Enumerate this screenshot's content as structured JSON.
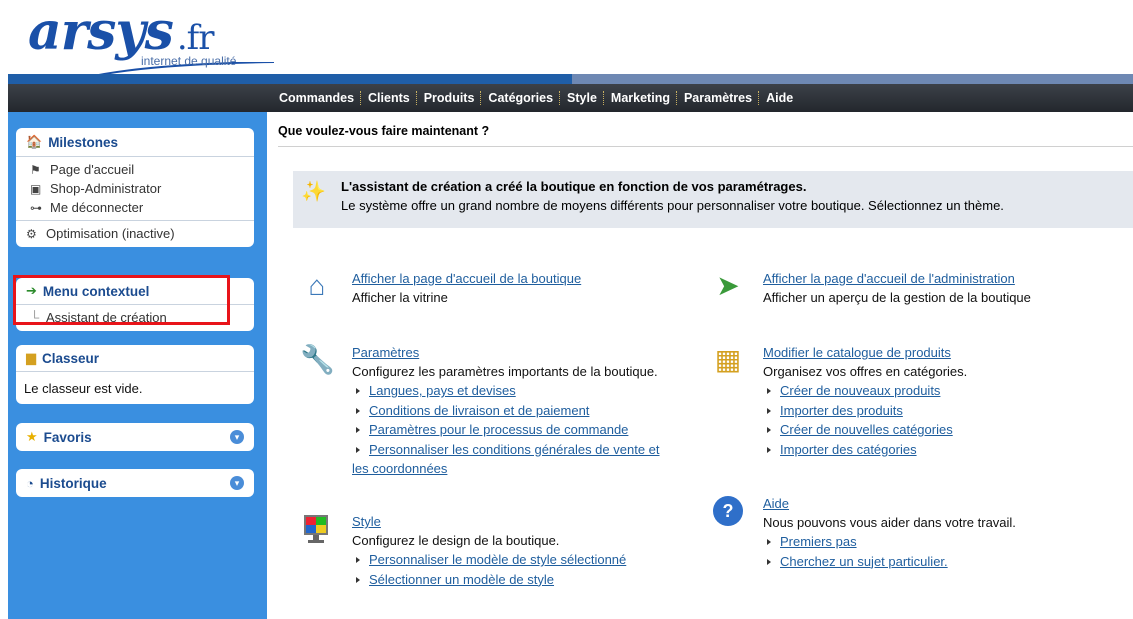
{
  "logo": {
    "name": "arsys",
    "tld": ".fr",
    "tagline": "internet de qualité"
  },
  "nav": [
    "Commandes",
    "Clients",
    "Produits",
    "Catégories",
    "Style",
    "Marketing",
    "Paramètres",
    "Aide"
  ],
  "sidebar": {
    "milestones": {
      "title": "Milestones",
      "items": [
        {
          "label": "Page d'accueil",
          "icon": "flag-icon"
        },
        {
          "label": "Shop-Administrator",
          "icon": "user-icon"
        },
        {
          "label": "Me déconnecter",
          "icon": "key-icon"
        }
      ],
      "optimisation": "Optimisation (inactive)"
    },
    "menu": {
      "title": "Menu contextuel",
      "item": "Assistant de création"
    },
    "classeur": {
      "title": "Classeur",
      "text": "Le classeur est vide."
    },
    "favoris": {
      "title": "Favoris"
    },
    "historique": {
      "title": "Historique"
    }
  },
  "main": {
    "question": "Que voulez-vous faire maintenant ?",
    "info": {
      "title": "L'assistant de création a créé la boutique en fonction de vos paramétrages.",
      "text": "Le système offre un grand nombre de moyens différents pour personnaliser votre boutique. Sélectionnez un thème."
    },
    "sections": {
      "home": {
        "title": "Afficher la page d'accueil de la boutique",
        "desc": "Afficher la vitrine"
      },
      "admin": {
        "title": "Afficher la page d'accueil de l'administration",
        "desc": "Afficher un aperçu de la gestion de la boutique"
      },
      "params": {
        "title": "Paramètres",
        "desc": "Configurez les paramètres importants de la boutique.",
        "links": [
          "Langues, pays et devises",
          "Conditions de livraison et de paiement",
          "Paramètres pour le processus de commande",
          "Personnaliser les conditions générales de vente et"
        ],
        "continuation": "les coordonnées"
      },
      "catalog": {
        "title": "Modifier le catalogue de produits",
        "desc": "Organisez vos offres en catégories.",
        "links": [
          "Créer de nouveaux produits",
          "Importer des produits",
          "Créer de nouvelles catégories",
          "Importer des catégories"
        ]
      },
      "style": {
        "title": "Style",
        "desc": "Configurez le design de la boutique.",
        "links": [
          "Personnaliser le modèle de style sélectionné",
          "Sélectionner un modèle de style"
        ]
      },
      "help": {
        "title": "Aide",
        "desc": "Nous pouvons vous aider dans votre travail.",
        "links": [
          "Premiers pas",
          "Cherchez un sujet particulier."
        ]
      }
    }
  }
}
